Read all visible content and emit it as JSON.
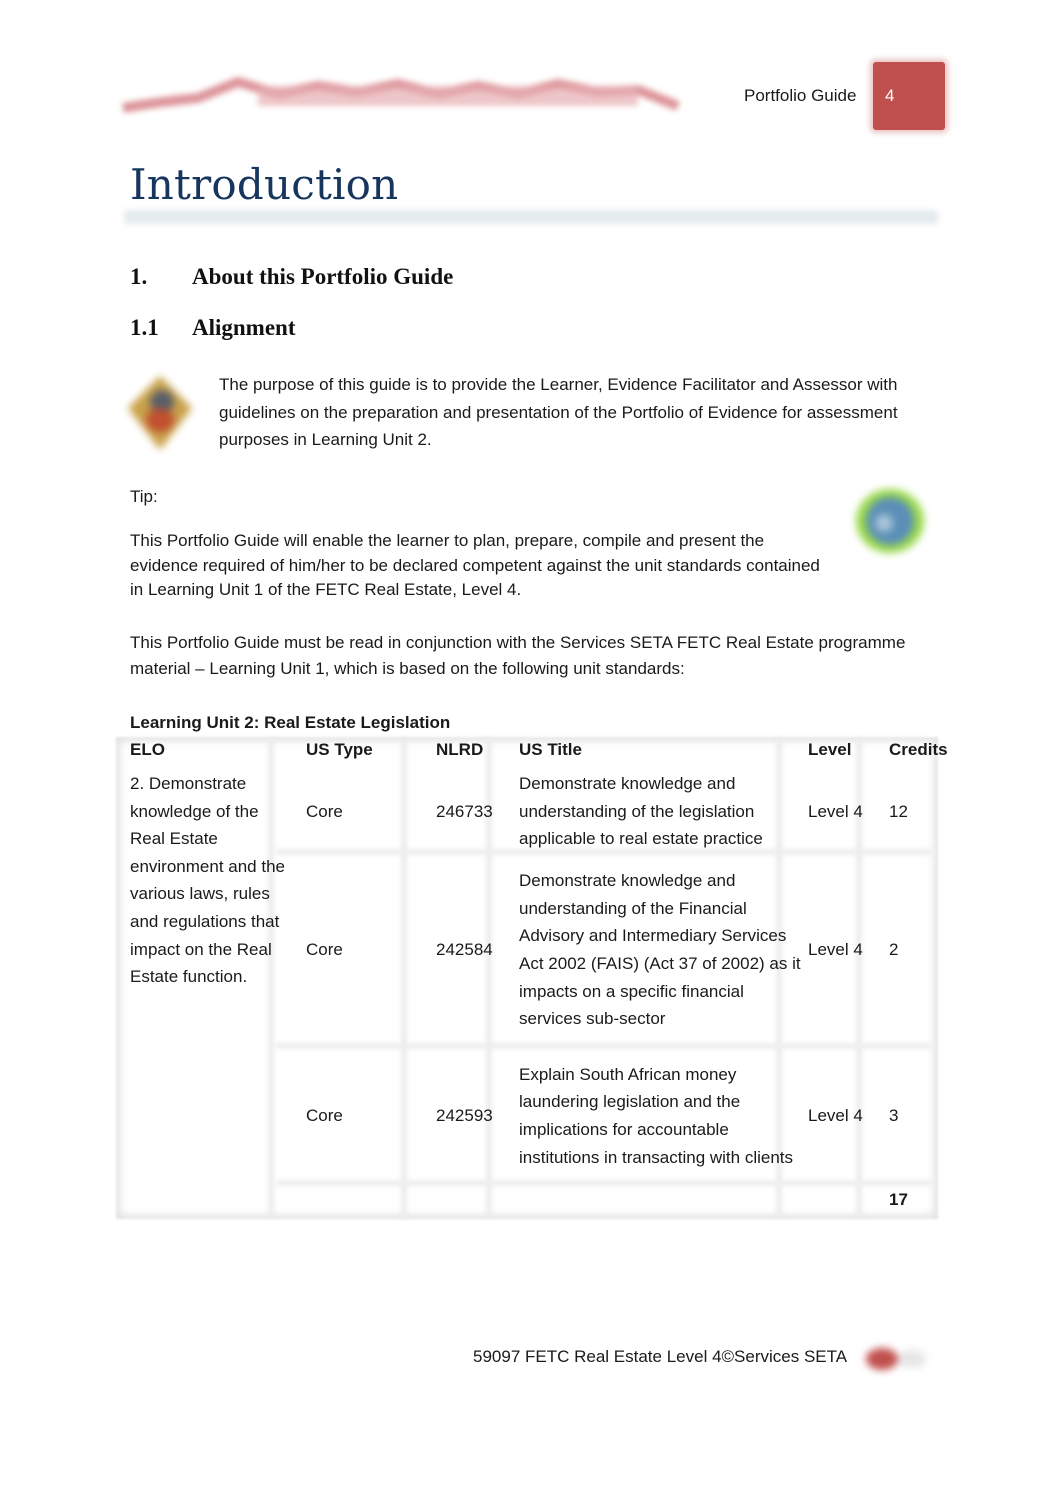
{
  "header": {
    "title": "Portfolio Guide",
    "page_number": "4",
    "brand_color": "#c0504d"
  },
  "section": {
    "title": "Introduction",
    "title_color": "#17365d"
  },
  "heading1": {
    "number": "1.",
    "text": "About this Portfolio Guide"
  },
  "heading2": {
    "number": "1.1",
    "text": "Alignment"
  },
  "paragraphs": {
    "purpose": "The purpose of this guide is to provide the Learner, Evidence Facilitator and Assessor with guidelines on the preparation and presentation of the Portfolio of Evidence for assessment purposes in Learning Unit 2.",
    "tip_label": "Tip:",
    "enable": "This Portfolio Guide will enable the learner to plan, prepare, compile and present the evidence required of him/her to be declared competent against the unit standards contained in Learning Unit 1 of the FETC Real Estate, Level 4.",
    "conjunction": "This Portfolio Guide must be read in conjunction with the Services SETA FETC Real Estate programme material – Learning Unit 1, which is based on the following unit standards:"
  },
  "table": {
    "caption": "Learning Unit 2: Real Estate Legislation",
    "headers": [
      "ELO",
      "US Type",
      "NLRD",
      "US Title",
      "Level",
      "Credits"
    ],
    "elo": "2. Demonstrate knowledge of the Real Estate environment and the various laws, rules and regulations that impact on the Real Estate function.",
    "rows": [
      {
        "type": "Core",
        "nlrd": "246733",
        "title": "Demonstrate knowledge and understanding of the legislation applicable to real estate practice",
        "level": "Level 4",
        "credits": "12"
      },
      {
        "type": "Core",
        "nlrd": "242584",
        "title": "Demonstrate knowledge and understanding of the Financial Advisory and Intermediary Services Act 2002 (FAIS) (Act 37 of 2002) as it impacts on a specific financial services sub-sector",
        "level": "Level 4",
        "credits": "2"
      },
      {
        "type": "Core",
        "nlrd": "242593",
        "title": "Explain South African money laundering legislation and the implications for accountable institutions in transacting with clients",
        "level": "Level 4",
        "credits": "3"
      }
    ],
    "total_credits": "17"
  },
  "footer": {
    "text": "59097 FETC Real Estate Level 4©Services SETA"
  },
  "icons": {
    "header_logo": "services-seta-logo-banner",
    "alignment": "crest-icon",
    "tip": "globe-icon",
    "footer": "footer-logo-mark"
  }
}
